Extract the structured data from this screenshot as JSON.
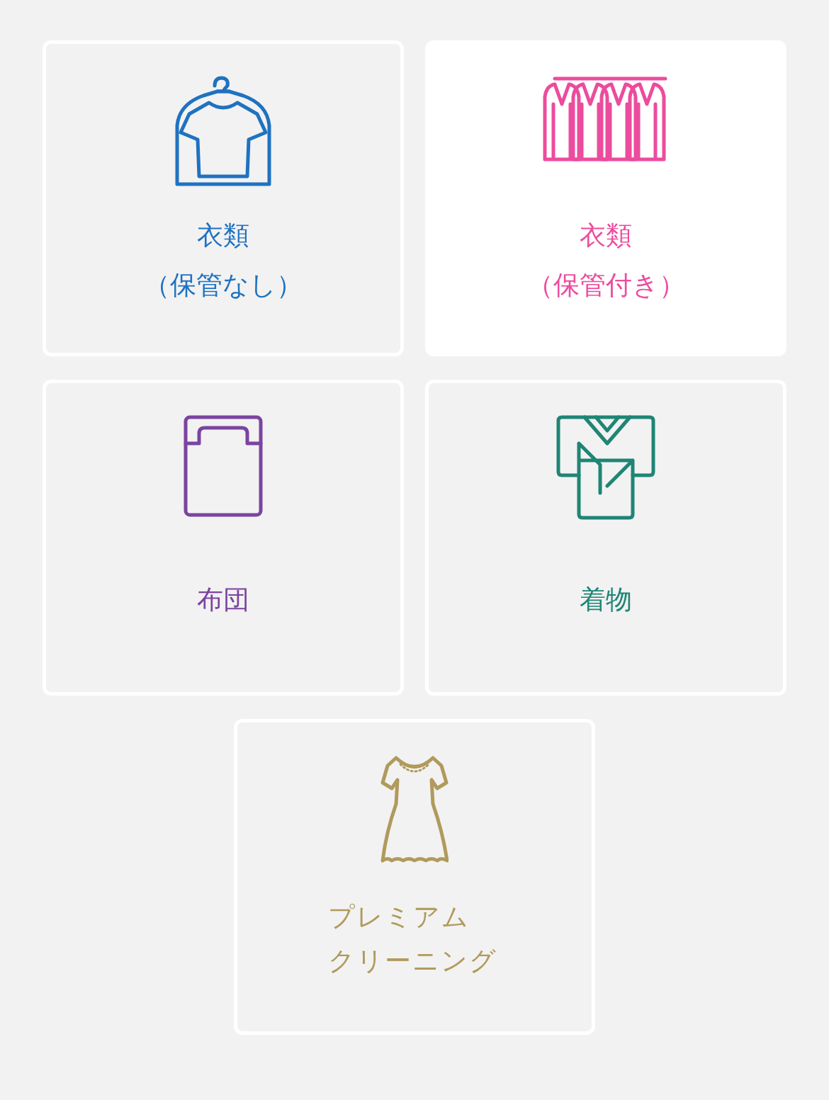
{
  "categories": [
    {
      "kind": "shirt",
      "lines": [
        "衣類",
        "（保管なし）"
      ],
      "color": "#1f72c0",
      "selected": false
    },
    {
      "kind": "rack",
      "lines": [
        "衣類",
        "（保管付き）"
      ],
      "color": "#ec4c9d",
      "selected": true
    },
    {
      "kind": "futon",
      "lines": [
        "布団"
      ],
      "color": "#7b44a0",
      "selected": false
    },
    {
      "kind": "kimono",
      "lines": [
        "着物"
      ],
      "color": "#1f8575",
      "selected": false
    },
    {
      "kind": "dress",
      "lines": [
        "プレミアム",
        "クリーニング"
      ],
      "color": "#b09a5c",
      "selected": false
    }
  ]
}
